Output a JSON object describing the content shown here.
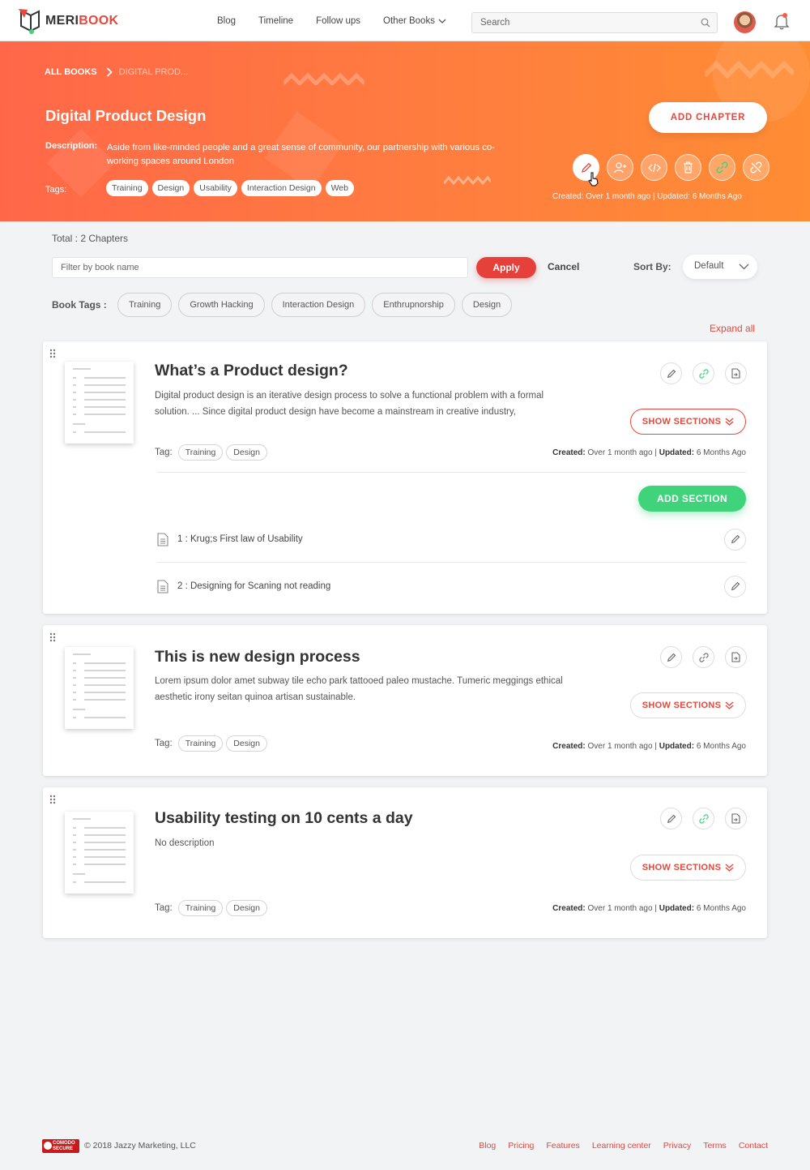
{
  "brand": {
    "part1": "MERI",
    "part2": "BOOK"
  },
  "nav": {
    "links": [
      "Blog",
      "Timeline",
      "Follow ups",
      "Other Books"
    ],
    "search_placeholder": "Search"
  },
  "hero": {
    "breadcrumb_root": "ALL BOOKS",
    "breadcrumb_current": "DIGITAL PROD...",
    "title": "Digital Product Design",
    "description_label": "Description:",
    "description": "Aside from like-minded people and a great sense of community, our partnership with various co-working spaces around London",
    "tags_label": "Tags:",
    "tags": [
      "Training",
      "Design",
      "Usability",
      "Interaction Design",
      "Web"
    ],
    "add_chapter_label": "ADD CHAPTER",
    "meta": "Created: Over 1 month ago | Updated: 6 Months Ago",
    "actions": [
      "edit-icon",
      "add-user-icon",
      "code-icon",
      "trash-icon",
      "link-icon",
      "unlink-icon"
    ]
  },
  "filters": {
    "total": "Total : 2 Chapters",
    "filter_placeholder": "Filter by book name",
    "apply_label": "Apply",
    "cancel_label": "Cancel",
    "sort_label": "Sort By:",
    "sort_value": "Default",
    "book_tags_label": "Book Tags :",
    "book_tags": [
      "Training",
      "Growth Hacking",
      "Interaction Design",
      "Enthrupnorship",
      "Design"
    ],
    "expand_all_label": "Expand all"
  },
  "chapters": [
    {
      "title": "What’s a Product design?",
      "description": "Digital product design is an iterative design process to solve a functional problem with a formal solution. ... Since digital product design have become a mainstream in creative industry,",
      "tag_label": "Tag:",
      "tags": [
        "Training",
        "Design"
      ],
      "created_label": "Created:",
      "created": "Over 1 month ago",
      "updated_label": "Updated:",
      "updated": "6 Months Ago",
      "show_sections_label": "SHOW SECTIONS",
      "add_section_label": "ADD SECTION",
      "sections": [
        "1 : Krug;s First law of Usability",
        "2 : Designing for Scaning not reading"
      ]
    },
    {
      "title": "This is new design process",
      "description": "Lorem ipsum dolor amet subway tile echo park tattooed paleo mustache. Tumeric meggings ethical aesthetic irony seitan quinoa artisan sustainable.",
      "tag_label": "Tag:",
      "tags": [
        "Training",
        "Design"
      ],
      "created_label": "Created:",
      "created": "Over 1 month ago",
      "updated_label": "Updated:",
      "updated": "6 Months Ago",
      "show_sections_label": "SHOW SECTIONS"
    },
    {
      "title": "Usability testing on 10 cents a day",
      "description": "No description",
      "tag_label": "Tag:",
      "tags": [
        "Training",
        "Design"
      ],
      "created_label": "Created:",
      "created": "Over 1 month ago",
      "updated_label": "Updated:",
      "updated": "6 Months Ago",
      "show_sections_label": "SHOW SECTIONS"
    }
  ],
  "footer": {
    "badge_line1": "COMODO",
    "badge_line2": "SECURE",
    "copyright": "© 2018 Jazzy Marketing, LLC",
    "links": [
      "Blog",
      "Pricing",
      "Features",
      "Learning center",
      "Privacy",
      "Terms",
      "Contact"
    ]
  },
  "colors": {
    "accent": "#e5483d",
    "hero_start": "#ff6748",
    "hero_end": "#ff8d34",
    "success": "#3fd47c"
  }
}
